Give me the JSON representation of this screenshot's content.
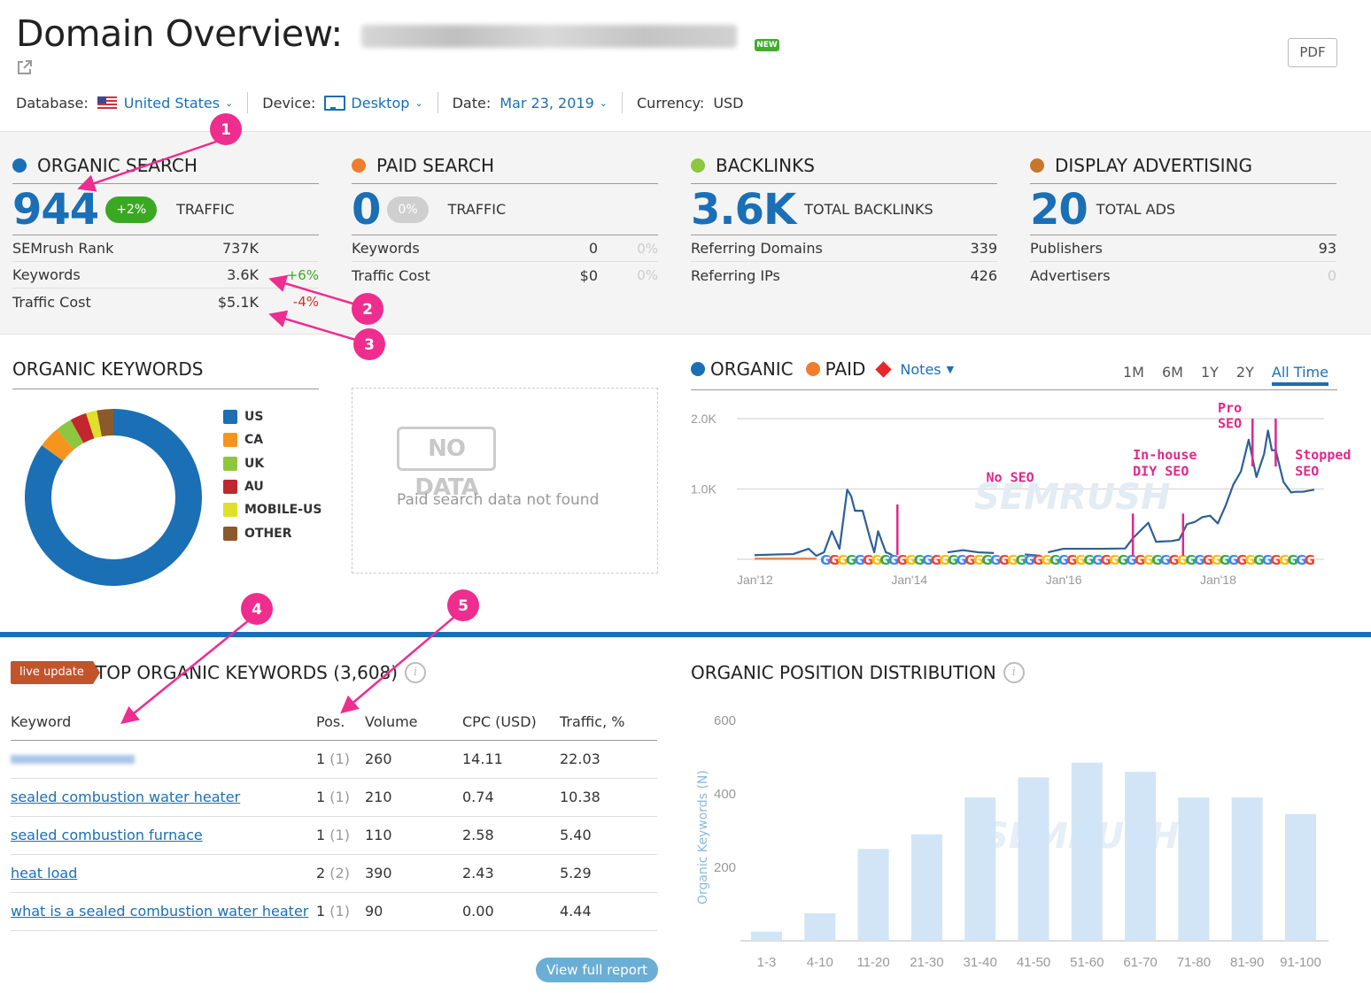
{
  "header": {
    "title": "Domain Overview:",
    "new_badge": "NEW",
    "pdf_label": "PDF",
    "filters": {
      "database_label": "Database:",
      "database_value": "United States",
      "device_label": "Device:",
      "device_value": "Desktop",
      "date_label": "Date:",
      "date_value": "Mar 23, 2019",
      "currency_label": "Currency:",
      "currency_value": "USD"
    }
  },
  "summary": {
    "organic": {
      "title": "ORGANIC SEARCH",
      "color": "#1a6fb5",
      "value": "944",
      "change": "+2%",
      "change_color": "#3ba824",
      "label": "TRAFFIC",
      "rows": [
        {
          "key": "SEMrush Rank",
          "value": "737K",
          "delta": ""
        },
        {
          "key": "Keywords",
          "value": "3.6K",
          "delta": "+6%",
          "delta_color": "#3ba824"
        },
        {
          "key": "Traffic Cost",
          "value": "$5.1K",
          "delta": "-4%",
          "delta_color": "#c0392b"
        }
      ]
    },
    "paid": {
      "title": "PAID SEARCH",
      "color": "#f07c2d",
      "value": "0",
      "change": "0%",
      "change_color": "#cfcfcf",
      "label": "TRAFFIC",
      "rows": [
        {
          "key": "Keywords",
          "value": "0",
          "delta": "0%",
          "delta_color": "#cccccc"
        },
        {
          "key": "Traffic Cost",
          "value": "$0",
          "delta": "0%",
          "delta_color": "#cccccc"
        }
      ]
    },
    "backlinks": {
      "title": "BACKLINKS",
      "color": "#8dc63f",
      "value": "3.6K",
      "label": "TOTAL BACKLINKS",
      "rows": [
        {
          "key": "Referring Domains",
          "value": "339"
        },
        {
          "key": "Referring IPs",
          "value": "426"
        }
      ]
    },
    "display": {
      "title": "DISPLAY ADVERTISING",
      "color": "#c8762a",
      "value": "20",
      "label": "TOTAL ADS",
      "rows": [
        {
          "key": "Publishers",
          "value": "93"
        },
        {
          "key": "Advertisers",
          "value": "0",
          "value_color": "#cccccc"
        }
      ]
    }
  },
  "organic_keywords": {
    "title": "ORGANIC KEYWORDS",
    "legend": [
      {
        "label": "US",
        "color": "#1a6fb5",
        "share": 0.85
      },
      {
        "label": "CA",
        "color": "#f7941d",
        "share": 0.04
      },
      {
        "label": "UK",
        "color": "#8dc63f",
        "share": 0.03
      },
      {
        "label": "AU",
        "color": "#c1272d",
        "share": 0.03
      },
      {
        "label": "MOBILE-US",
        "color": "#e0e02a",
        "share": 0.02
      },
      {
        "label": "OTHER",
        "color": "#8b5a2b",
        "share": 0.03
      }
    ]
  },
  "paid_nodata": {
    "badge": "NO DATA",
    "message": "Paid search data not found"
  },
  "trend": {
    "legend": {
      "organic": "ORGANIC",
      "paid": "PAID",
      "notes": "Notes"
    },
    "colors": {
      "organic": "#1a6fb5",
      "paid": "#f07c2d",
      "line": "#2d5f95",
      "annotation": "#e0288a"
    },
    "ranges": [
      "1M",
      "6M",
      "1Y",
      "2Y",
      "All Time"
    ],
    "active_range": "All Time",
    "annotations": [
      {
        "text": "No SEO"
      },
      {
        "text": "In-house"
      },
      {
        "text": "DIY SEO"
      },
      {
        "text": "Pro"
      },
      {
        "text": "SEO"
      },
      {
        "text": "Stopped"
      },
      {
        "text": "SEO"
      }
    ]
  },
  "top_keywords": {
    "live_badge": "live update",
    "title": "TOP ORGANIC KEYWORDS (3,608)",
    "info": "i",
    "columns": [
      "Keyword",
      "Pos.",
      "Volume",
      "CPC (USD)",
      "Traffic, %"
    ],
    "rows": [
      {
        "keyword": "",
        "blurred": true,
        "pos": "1",
        "prev": "(1)",
        "volume": "260",
        "cpc": "14.11",
        "traffic": "22.03"
      },
      {
        "keyword": "sealed combustion water heater",
        "pos": "1",
        "prev": "(1)",
        "volume": "210",
        "cpc": "0.74",
        "traffic": "10.38"
      },
      {
        "keyword": "sealed combustion furnace",
        "pos": "1",
        "prev": "(1)",
        "volume": "110",
        "cpc": "2.58",
        "traffic": "5.40"
      },
      {
        "keyword": "heat load",
        "pos": "2",
        "prev": "(2)",
        "volume": "390",
        "cpc": "2.43",
        "traffic": "5.29"
      },
      {
        "keyword": "what is a sealed combustion water heater",
        "pos": "1",
        "prev": "(1)",
        "volume": "90",
        "cpc": "0.00",
        "traffic": "4.44"
      }
    ],
    "view_full_report": "View full report"
  },
  "position_distribution": {
    "title": "ORGANIC POSITION DISTRIBUTION",
    "info": "i"
  },
  "annotation_markers": [
    "1",
    "2",
    "3",
    "4",
    "5"
  ],
  "chart_data": [
    {
      "type": "pie",
      "title": "ORGANIC KEYWORDS",
      "categories": [
        "US",
        "CA",
        "UK",
        "AU",
        "MOBILE-US",
        "OTHER"
      ],
      "values": [
        85,
        4,
        3,
        3,
        2,
        3
      ],
      "legend": "right"
    },
    {
      "type": "line",
      "title": "Organic traffic trend",
      "x_ticks": [
        "Jan'12",
        "Jan'14",
        "Jan'16",
        "Jan'18"
      ],
      "y_ticks": [
        "1.0K",
        "2.0K"
      ],
      "ylim": [
        0,
        2200
      ],
      "xlim": [
        2012.0,
        2019.25
      ],
      "grid": true,
      "series": [
        {
          "name": "ORGANIC",
          "x": [
            2012.0,
            2012.3,
            2012.5,
            2012.7,
            2012.8,
            2012.9,
            2013.0,
            2013.1,
            2013.2,
            2013.25,
            2013.3,
            2013.4,
            2013.5,
            2013.55,
            2013.6,
            2013.7,
            2013.75,
            2013.8
          ],
          "values": [
            60,
            70,
            75,
            150,
            50,
            100,
            400,
            150,
            990,
            900,
            690,
            690,
            280,
            100,
            400,
            100,
            80,
            40
          ]
        },
        {
          "name": "ORGANIC",
          "x": [
            2014.5,
            2014.7,
            2014.9,
            2015.1
          ],
          "values": [
            100,
            130,
            100,
            90
          ]
        },
        {
          "name": "ORGANIC",
          "x": [
            2015.5,
            2015.7
          ],
          "values": [
            70,
            50
          ]
        },
        {
          "name": "ORGANIC",
          "x": [
            2015.8,
            2016.0,
            2016.5,
            2016.8,
            2016.9,
            2017.1,
            2017.2,
            2017.4,
            2017.5,
            2017.6,
            2017.7,
            2017.8,
            2017.9,
            2018.0,
            2018.1,
            2018.2,
            2018.3,
            2018.4,
            2018.5,
            2018.6,
            2018.65,
            2018.7,
            2018.75,
            2018.85,
            2018.95,
            2019.0,
            2019.1,
            2019.2,
            2019.25
          ],
          "values": [
            100,
            150,
            150,
            155,
            300,
            520,
            250,
            260,
            280,
            500,
            530,
            600,
            620,
            510,
            760,
            1060,
            1250,
            1700,
            1170,
            1500,
            1830,
            1550,
            1550,
            1100,
            950,
            960,
            960,
            980,
            990
          ]
        },
        {
          "name": "PAID",
          "x": [
            2012.0,
            2012.8
          ],
          "values": [
            10,
            10
          ]
        }
      ],
      "annotations": [
        {
          "text": "No SEO",
          "x": 2013.85
        },
        {
          "text": "In-house DIY SEO",
          "x": 2016.9
        },
        {
          "text": "In-house DIY SEO",
          "x": 2017.55
        },
        {
          "text": "Pro SEO",
          "x": 2018.45
        },
        {
          "text": "Stopped SEO",
          "x": 2018.75
        }
      ]
    },
    {
      "type": "bar",
      "title": "ORGANIC POSITION DISTRIBUTION",
      "categories": [
        "1-3",
        "4-10",
        "11-20",
        "21-30",
        "31-40",
        "41-50",
        "51-60",
        "61-70",
        "71-80",
        "81-90",
        "91-100"
      ],
      "values": [
        25,
        75,
        250,
        290,
        390,
        445,
        485,
        460,
        390,
        390,
        345
      ],
      "xlabel": "",
      "ylabel": "Organic Keywords (N)",
      "y_ticks": [
        200,
        400,
        600
      ],
      "ylim": [
        0,
        600
      ],
      "color": "#cfe4f7"
    }
  ]
}
